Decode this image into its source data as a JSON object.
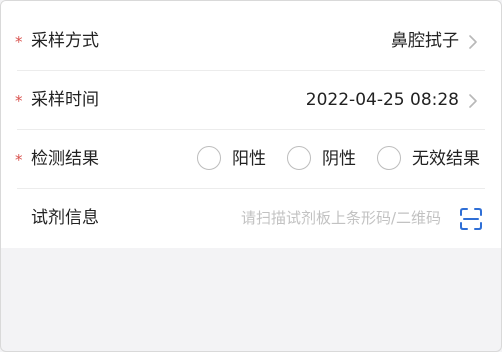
{
  "form": {
    "sampling_method": {
      "required_mark": "*",
      "label": "采样方式",
      "value": "鼻腔拭子",
      "chevron_icon": "chevron-right-icon"
    },
    "sampling_time": {
      "required_mark": "*",
      "label": "采样时间",
      "value": "2022-04-25 08:28",
      "chevron_icon": "chevron-right-icon"
    },
    "test_result": {
      "required_mark": "*",
      "label": "检测结果",
      "options": [
        {
          "label": "阳性",
          "selected": false
        },
        {
          "label": "阴性",
          "selected": false
        },
        {
          "label": "无效结果",
          "selected": false
        }
      ]
    },
    "reagent_info": {
      "label": "试剂信息",
      "placeholder": "请扫描试剂板上条形码/二维码",
      "scan_icon": "scan-icon"
    }
  },
  "colors": {
    "required": "#d9534f",
    "text": "#222222",
    "placeholder": "#c2c2c2",
    "scan_icon": "#2f6fd6",
    "background": "#f3f3f5"
  }
}
